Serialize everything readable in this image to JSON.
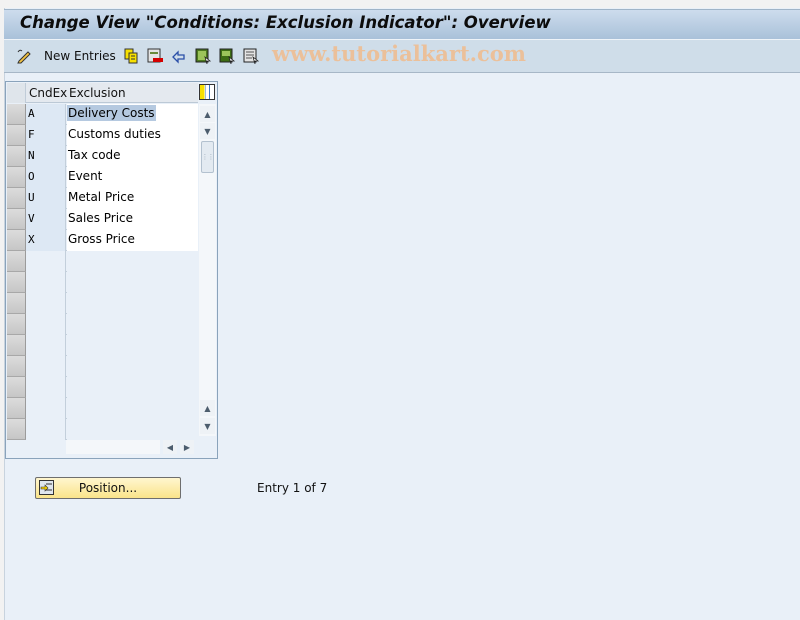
{
  "window": {
    "title": "Change View \"Conditions: Exclusion Indicator\": Overview"
  },
  "toolbar": {
    "items": [
      {
        "icon": "edit-pencil-icon",
        "label": ""
      },
      {
        "icon": "new-entries-label",
        "label": "New Entries"
      },
      {
        "icon": "copy-as-icon",
        "label": ""
      },
      {
        "icon": "delete-icon",
        "label": ""
      },
      {
        "icon": "undo-change-icon",
        "label": ""
      },
      {
        "icon": "select-all-icon",
        "label": ""
      },
      {
        "icon": "select-block-icon",
        "label": ""
      },
      {
        "icon": "deselect-all-icon",
        "label": ""
      }
    ],
    "new_entries_label": "New Entries",
    "watermark": "www.tutorialkart.com"
  },
  "table": {
    "columns": [
      "CndEx",
      "Exclusion"
    ],
    "rows": [
      {
        "code": "A",
        "exclusion": "Delivery Costs",
        "selected": true
      },
      {
        "code": "F",
        "exclusion": "Customs duties"
      },
      {
        "code": "N",
        "exclusion": "Tax code"
      },
      {
        "code": "O",
        "exclusion": "Event"
      },
      {
        "code": "U",
        "exclusion": "Metal Price"
      },
      {
        "code": "V",
        "exclusion": "Sales Price"
      },
      {
        "code": "X",
        "exclusion": "Gross Price"
      }
    ],
    "empty_rows": 9
  },
  "footer": {
    "position_button": "Position...",
    "entry_info": "Entry 1 of 7"
  },
  "colors": {
    "title_bar": "#b8cce0",
    "toolbar": "#cfdde9",
    "background": "#e9f0f8",
    "position_button": "#fae48a",
    "selection_highlight": "#b5c9e0",
    "watermark": "#ebc09a"
  }
}
